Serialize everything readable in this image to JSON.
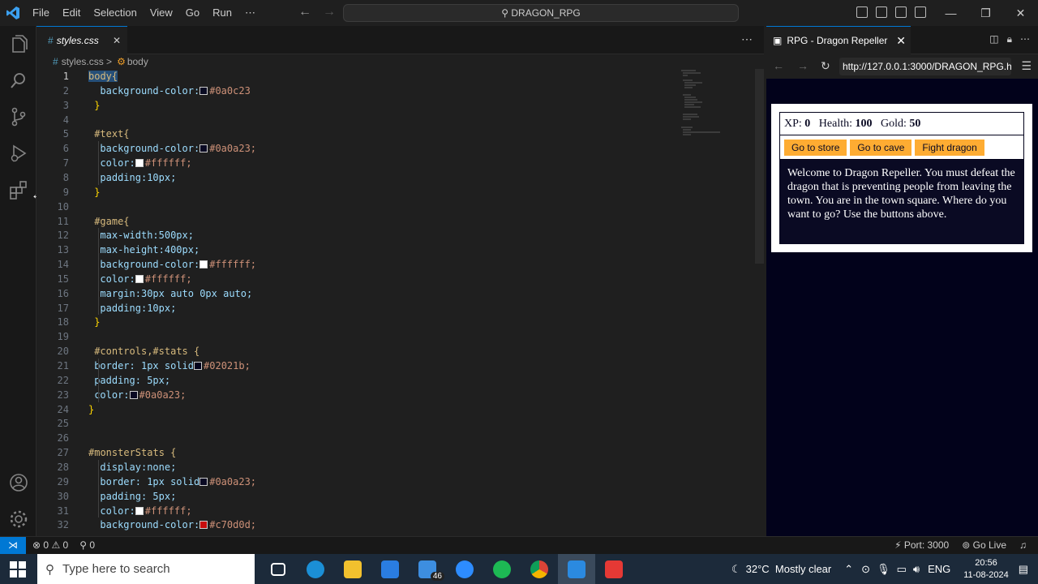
{
  "titlebar": {
    "menu": [
      "File",
      "Edit",
      "Selection",
      "View",
      "Go",
      "Run",
      "⋯"
    ],
    "search": "DRAGON_RPG"
  },
  "editor": {
    "tab_label": "styles.css",
    "breadcrumb_file": "styles.css",
    "breadcrumb_symbol": "body",
    "lines": [
      {
        "n": "1",
        "text": "body{"
      },
      {
        "n": "2",
        "text": "background-color:",
        "val": "#0a0c23"
      },
      {
        "n": "3",
        "text": "}"
      },
      {
        "n": "4",
        "text": ""
      },
      {
        "n": "5",
        "text": "#text{"
      },
      {
        "n": "6",
        "text": "background-color:",
        "val": "#0a0a23;"
      },
      {
        "n": "7",
        "text": "color:",
        "val": "#ffffff;"
      },
      {
        "n": "8",
        "text": "padding:10px;"
      },
      {
        "n": "9",
        "text": "}"
      },
      {
        "n": "10",
        "text": ""
      },
      {
        "n": "11",
        "text": "#game{"
      },
      {
        "n": "12",
        "text": "max-width:500px;"
      },
      {
        "n": "13",
        "text": "max-height:400px;"
      },
      {
        "n": "14",
        "text": "background-color:",
        "val": "#ffffff;"
      },
      {
        "n": "15",
        "text": "color:",
        "val": "#ffffff;"
      },
      {
        "n": "16",
        "text": "margin:30px auto 0px auto;"
      },
      {
        "n": "17",
        "text": "padding:10px;"
      },
      {
        "n": "18",
        "text": "}"
      },
      {
        "n": "19",
        "text": ""
      },
      {
        "n": "20",
        "text": "#controls,#stats {"
      },
      {
        "n": "21",
        "text": "border: 1px solid",
        "val": "#02021b;"
      },
      {
        "n": "22",
        "text": "padding: 5px;"
      },
      {
        "n": "23",
        "text": "color:",
        "val": "#0a0a23;"
      },
      {
        "n": "24",
        "text": "}"
      },
      {
        "n": "25",
        "text": ""
      },
      {
        "n": "26",
        "text": ""
      },
      {
        "n": "27",
        "text": "#monsterStats {"
      },
      {
        "n": "28",
        "text": "display:none;"
      },
      {
        "n": "29",
        "text": "border: 1px solid",
        "val": "#0a0a23;"
      },
      {
        "n": "30",
        "text": "padding: 5px;"
      },
      {
        "n": "31",
        "text": "color:",
        "val": "#ffffff;"
      },
      {
        "n": "32",
        "text": "background-color:",
        "val": "#c70d0d;"
      }
    ]
  },
  "browser": {
    "tab_title": "RPG - Dragon Repeller",
    "url": "http://127.0.0.1:3000/DRAGON_RPG.h",
    "stats": {
      "xp_label": "XP:",
      "xp": "0",
      "health_label": "Health:",
      "health": "100",
      "gold_label": "Gold:",
      "gold": "50"
    },
    "buttons": [
      "Go to store",
      "Go to cave",
      "Fight dragon"
    ],
    "text": "Welcome to Dragon Repeller. You must defeat the dragon that is preventing people from leaving the town. You are in the town square. Where do you want to go? Use the buttons above."
  },
  "statusbar": {
    "errors": "0",
    "warnings": "0",
    "ports": "0",
    "port": "Port: 3000",
    "golive": "Go Live"
  },
  "taskbar": {
    "search_placeholder": "Type here to search",
    "weather": "32°C  Mostly clear",
    "lang": "ENG",
    "time": "20:56",
    "date": "11-08-2024",
    "mail_badge": "46"
  },
  "colors": {
    "swatch_0a0c23": "#0a0c23",
    "swatch_red": "#c70d0d",
    "accent": "#0078d4",
    "button": "#feac32"
  }
}
